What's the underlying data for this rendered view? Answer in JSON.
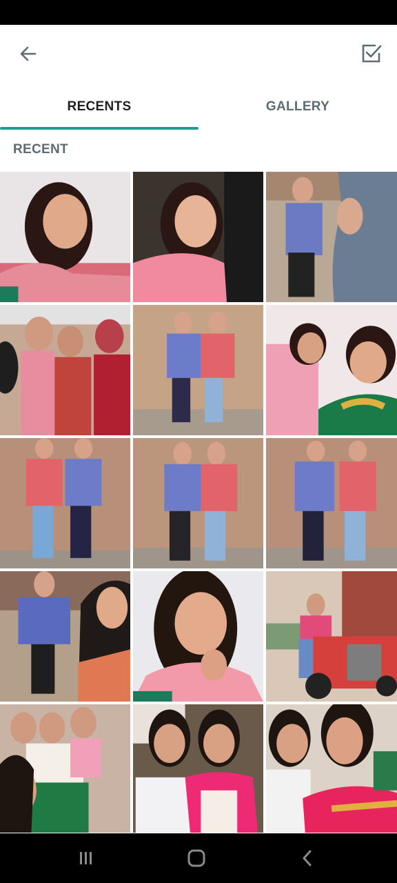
{
  "header": {
    "back_icon": "arrow-left-icon",
    "select_icon": "checkbox-checked-icon"
  },
  "tabs": [
    {
      "label": "RECENTS",
      "active": true
    },
    {
      "label": "GALLERY",
      "active": false
    }
  ],
  "section": {
    "title": "RECENT"
  },
  "colors": {
    "accent": "#20a08c",
    "tab_active_text": "#1f1f1f",
    "tab_inactive_text": "#5f6b73"
  },
  "nav": {
    "recents_icon": "recent-apps-icon",
    "home_icon": "home-icon",
    "back_icon": "back-chevron-icon"
  }
}
